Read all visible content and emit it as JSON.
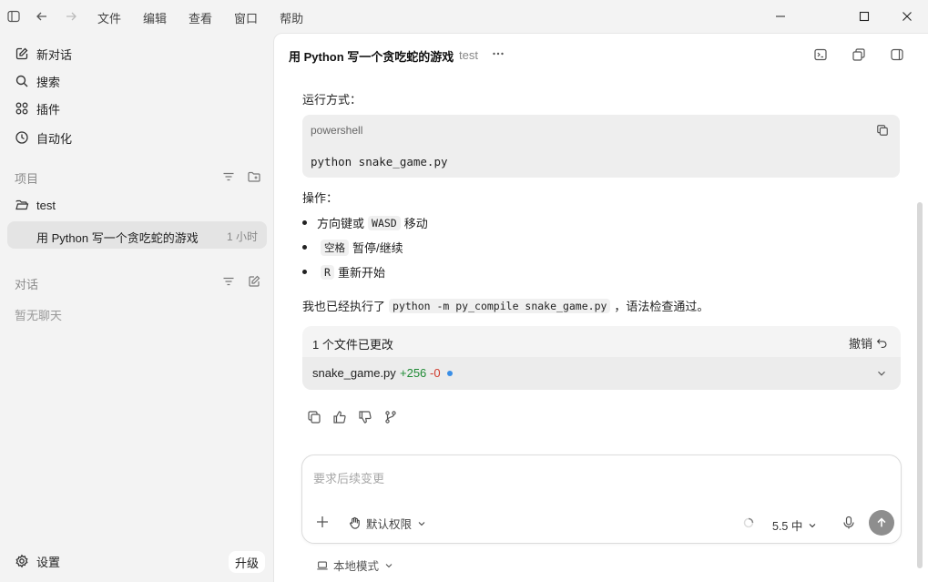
{
  "menu": [
    "文件",
    "编辑",
    "查看",
    "窗口",
    "帮助"
  ],
  "sidebar": {
    "nav": [
      {
        "label": "新对话",
        "icon": "compose-icon"
      },
      {
        "label": "搜索",
        "icon": "search-icon"
      },
      {
        "label": "插件",
        "icon": "plugins-icon"
      },
      {
        "label": "自动化",
        "icon": "clock-icon"
      }
    ],
    "projects_header": "项目",
    "project_name": "test",
    "conversation": {
      "title": "用 Python 写一个贪吃蛇的游戏",
      "time": "1 小时"
    },
    "chats_header": "对话",
    "empty_chats": "暂无聊天",
    "settings_label": "设置",
    "upgrade_label": "升级"
  },
  "main": {
    "title": "用 Python 写一个贪吃蛇的游戏",
    "project": "test",
    "run_heading": "运行方式：",
    "code_lang": "powershell",
    "code_line": "python snake_game.py",
    "ops_heading": "操作：",
    "bullets": [
      {
        "pre": "方向键或",
        "code": "WASD",
        "post": "移动"
      },
      {
        "pre": "",
        "code": "空格",
        "post": "暂停/继续"
      },
      {
        "pre": "",
        "code": "R",
        "post": "重新开始"
      }
    ],
    "summary_pre": "我也已经执行了",
    "summary_code": "python -m py_compile snake_game.py",
    "summary_post": "，语法检查通过。",
    "files_changed": "1 个文件已更改",
    "undo_label": "撤销",
    "file_name": "snake_game.py",
    "added": "+256",
    "removed": "-0",
    "input_placeholder": "要求后续变更",
    "permission_label": "默认权限",
    "model_label": "5.5 中",
    "mode_label": "本地模式"
  },
  "colors": {
    "added": "#1e8a34",
    "removed": "#d03a2c",
    "modified_dot": "#3a8ee6"
  }
}
